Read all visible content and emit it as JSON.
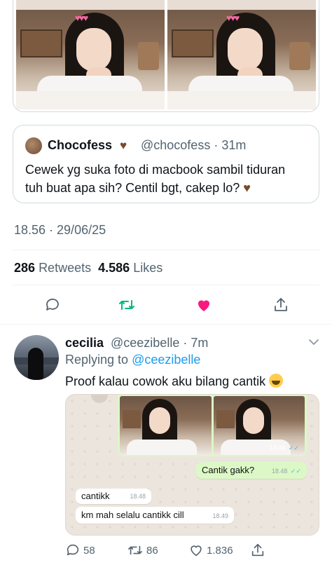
{
  "quoted_tweet": {
    "author_name": "Chocofess",
    "author_badge": "brown-heart",
    "handle": "@chocofess",
    "time": "31m",
    "text_line1": "Cewek yg suka foto di macbook sambil tiduran",
    "text_line2": "tuh buat apa sih? Centil bgt, cakep lo?"
  },
  "main_tweet": {
    "timestamp": "18.56 · 29/06/25",
    "retweets_count": "286",
    "retweets_label": "Retweets",
    "likes_count": "4.586",
    "likes_label": "Likes",
    "liked_color": "#f91880",
    "retweet_color": "#00ba7c"
  },
  "reply": {
    "author_name": "cecilia",
    "handle": "@ceezibelle",
    "time": "7m",
    "replying_prefix": "Replying to",
    "replying_handle": "@ceezibelle",
    "text": "Proof kalau cowok aku bilang cantik",
    "chat": {
      "photo_time": "18.48",
      "outgoing_text": "Cantik gakk?",
      "outgoing_time": "18.48",
      "incoming": [
        {
          "text": "cantikk",
          "time": "18.48"
        },
        {
          "text": "km mah selalu cantikk cill",
          "time": "18.49"
        }
      ]
    },
    "replies_count": "58",
    "retweets_count": "86",
    "likes_count": "1.836"
  }
}
